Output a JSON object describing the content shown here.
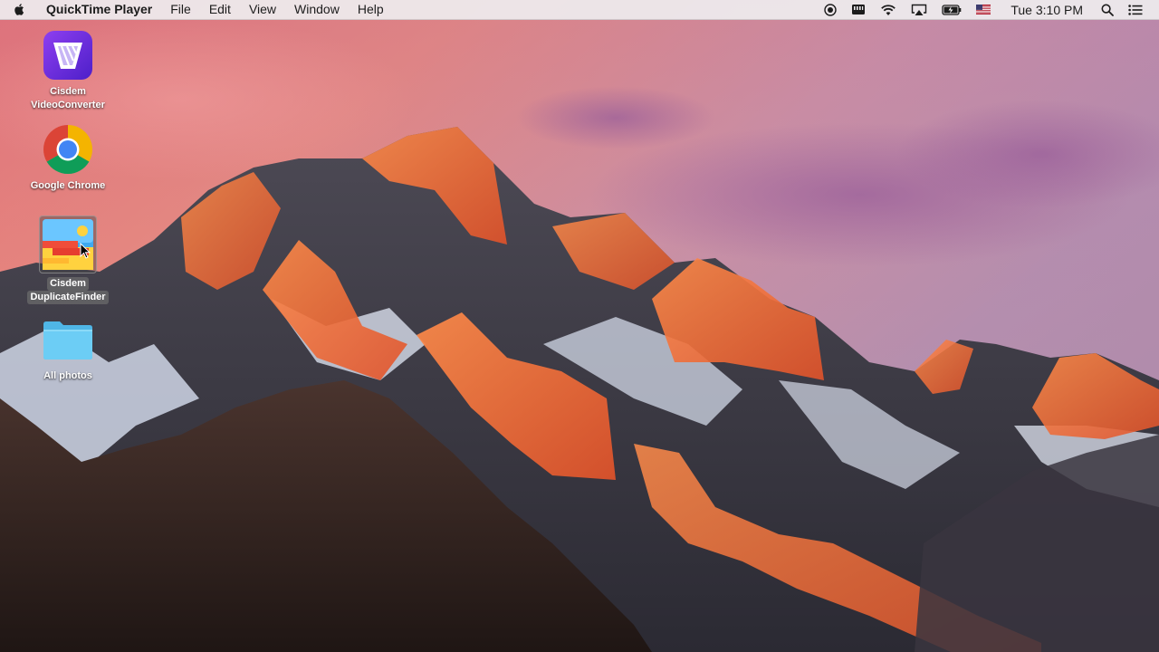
{
  "menubar": {
    "app_name": "QuickTime Player",
    "menus": [
      "File",
      "Edit",
      "View",
      "Window",
      "Help"
    ],
    "clock": "Tue 3:10 PM"
  },
  "desktop": {
    "icons": [
      {
        "label_lines": [
          "Cisdem",
          "VideoConverter"
        ]
      },
      {
        "label_lines": [
          "Google Chrome"
        ]
      },
      {
        "label_lines": [
          "Cisdem",
          "DuplicateFinder"
        ],
        "selected": true
      },
      {
        "label_lines": [
          "All photos"
        ]
      }
    ]
  },
  "colors": {
    "menubar_bg": "#eeecee",
    "chrome_red": "#db4437",
    "chrome_yellow": "#f4b400",
    "chrome_green": "#0f9d58",
    "chrome_blue": "#4285f4",
    "folder_blue": "#6ccdf5"
  }
}
